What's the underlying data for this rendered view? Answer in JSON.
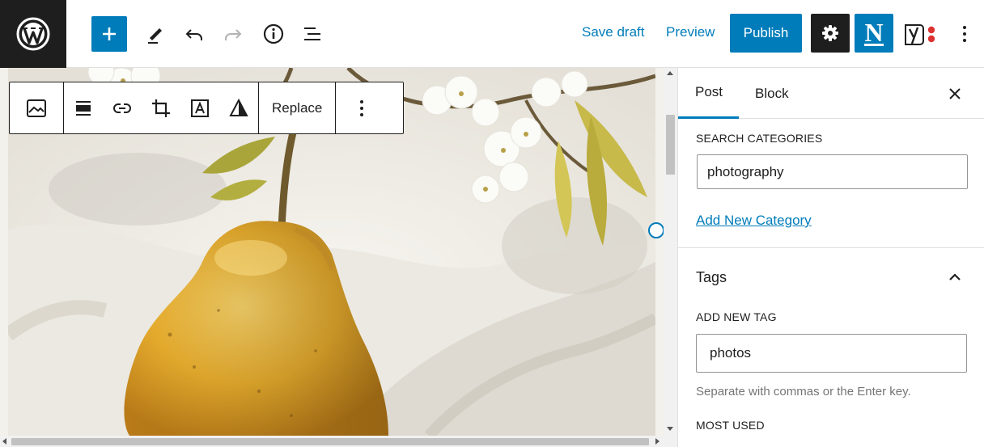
{
  "header": {
    "save_draft": "Save draft",
    "preview": "Preview",
    "publish": "Publish",
    "plugin_letter": "N",
    "icons": [
      "wordpress-icon",
      "plus-icon",
      "pencil-icon",
      "undo-icon",
      "redo-icon",
      "info-icon",
      "list-view-icon",
      "gear-icon",
      "yoast-icon",
      "more-vertical-icon"
    ]
  },
  "block_toolbar": {
    "replace": "Replace",
    "icons": [
      "image-icon",
      "align-icon",
      "link-icon",
      "crop-icon",
      "text-overlay-icon",
      "duotone-icon",
      "more-vertical-icon"
    ]
  },
  "sidebar": {
    "tabs": [
      {
        "label": "Post"
      },
      {
        "label": "Block"
      }
    ],
    "categories": {
      "search_label": "SEARCH CATEGORIES",
      "search_value": "photography",
      "add_new_link": "Add New Category"
    },
    "tags": {
      "title": "Tags",
      "add_label": "ADD NEW TAG",
      "input_value": "photos",
      "help": "Separate with commas or the Enter key.",
      "most_used": "MOST USED"
    }
  },
  "colors": {
    "accent": "#007cba",
    "dark": "#1e1e1e",
    "pear": "#e9b23a",
    "leaf": "#b7b03a"
  }
}
